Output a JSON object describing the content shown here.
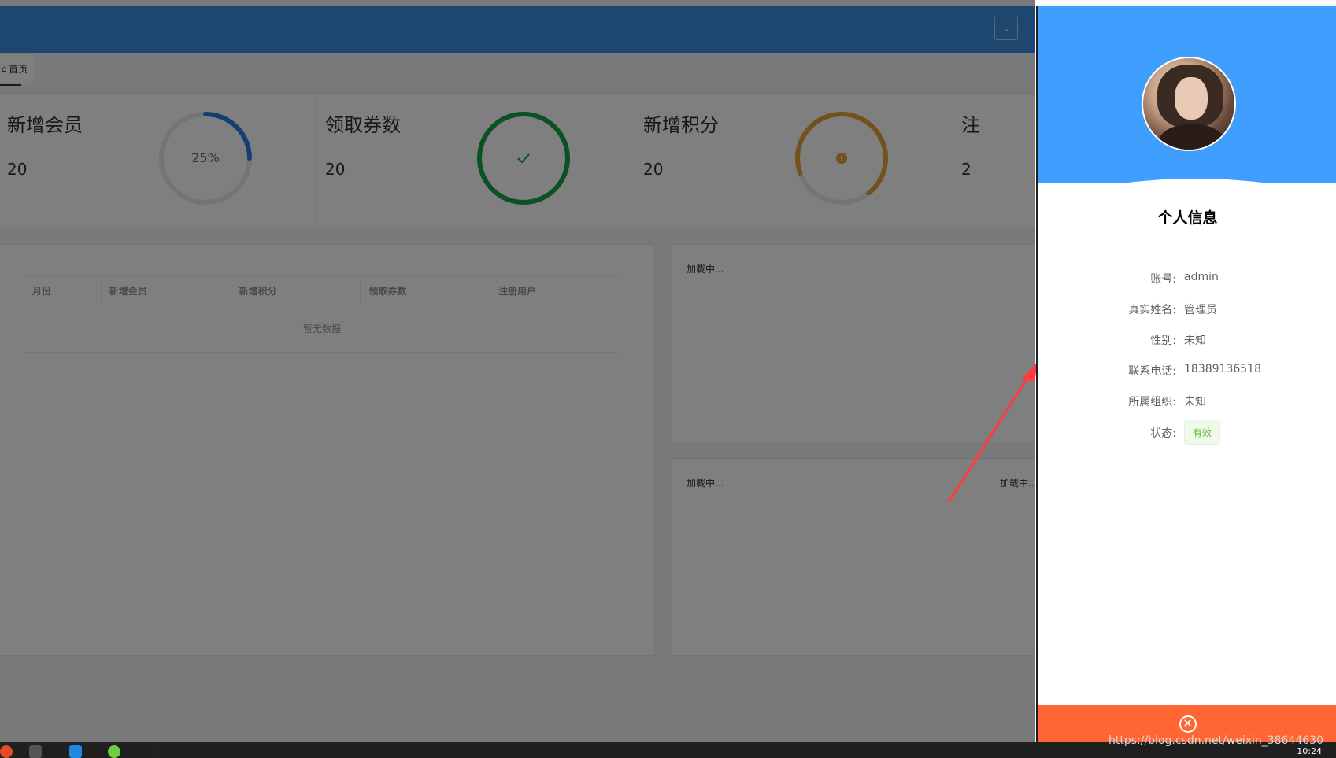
{
  "tabs": {
    "home_label": "首页"
  },
  "stats": [
    {
      "title": "新增会员",
      "value": "20",
      "ring_label": "25%",
      "ring_color": "#2681e0",
      "ring_progress": 0.25,
      "ring_status": ""
    },
    {
      "title": "领取券数",
      "value": "20",
      "ring_label": "",
      "ring_color": "#16a34a",
      "ring_progress": 1.0,
      "ring_status": "success-icon"
    },
    {
      "title": "新增积分",
      "value": "20",
      "ring_label": "",
      "ring_color": "#e6a23c",
      "ring_progress": 0.7,
      "ring_status": "warning-icon"
    }
  ],
  "partial_card": {
    "title": "注",
    "value": "2"
  },
  "table": {
    "columns": [
      "月份",
      "新增会员",
      "新增积分",
      "领取券数",
      "注册用户"
    ],
    "empty_text": "暂无数据"
  },
  "loading": {
    "chart1": "加載中...",
    "chart2": "加載中...",
    "chart3": "加載中..."
  },
  "profile": {
    "title": "个人信息",
    "fields": [
      {
        "label": "账号:",
        "value": "admin"
      },
      {
        "label": "真实姓名:",
        "value": "管理员"
      },
      {
        "label": "性别:",
        "value": "未知"
      },
      {
        "label": "联系电话:",
        "value": "18389136518"
      },
      {
        "label": "所属组织:",
        "value": "未知"
      },
      {
        "label": "状态:",
        "value": "有效"
      }
    ]
  },
  "watermark": "https://blog.csdn.net/weixin_38644630",
  "clock": "10:24",
  "colors": {
    "header": "#409eff",
    "footer": "#ff6633",
    "topbar": "#3d8fe0",
    "status_ok": "#67c23a"
  }
}
